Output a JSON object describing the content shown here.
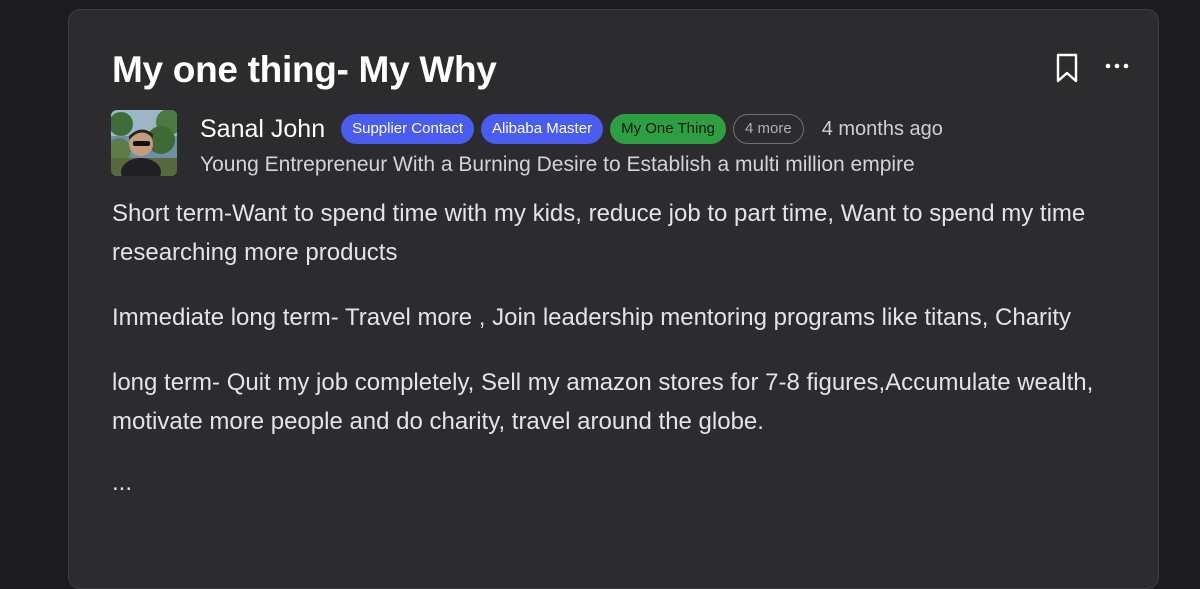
{
  "post": {
    "title": "My one thing- My Why",
    "author": {
      "name": "Sanal John",
      "tagline": "Young Entrepreneur With a Burning Desire to Establish a multi million empire"
    },
    "badges": [
      {
        "label": "Supplier Contact",
        "color": "#4a5cf0",
        "text_color": "#ffffff"
      },
      {
        "label": "Alibaba Master",
        "color": "#4a5cf0",
        "text_color": "#ffffff"
      },
      {
        "label": "My One Thing",
        "color": "#2e9e43",
        "text_color": "#0c1a0e"
      }
    ],
    "more_badges": "4 more",
    "timestamp": "4 months ago",
    "paragraphs": [
      "Short term-Want to spend time with my kids, reduce job to part time, Want to spend my time researching more products",
      "Immediate long term- Travel more , Join leadership mentoring programs like titans, Charity",
      "long term- Quit my job completely, Sell my amazon stores for 7-8 figures,Accumulate wealth,  motivate more people and do charity, travel around the globe."
    ],
    "truncation": "..."
  },
  "actions": {
    "bookmark_icon": "bookmark-icon",
    "more_icon": "more-options-icon"
  },
  "colors": {
    "page_background": "#1c1c1e",
    "card_background": "#2c2c2e",
    "card_border": "#3d3d40",
    "accent_blue": "#4a5cf0",
    "accent_green": "#2e9e43"
  }
}
